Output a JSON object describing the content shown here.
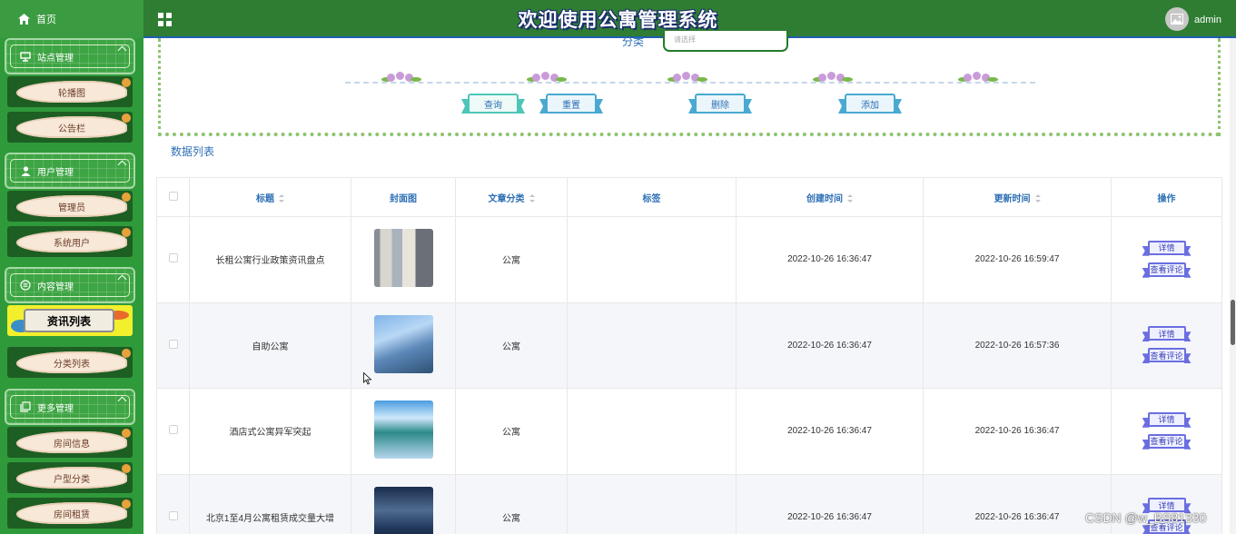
{
  "header": {
    "home_label": "首页",
    "system_title": "欢迎使用公寓管理系统",
    "username": "admin"
  },
  "sidebar": {
    "groups": [
      {
        "label": "站点管理",
        "icon": "monitor-icon",
        "items": [
          "轮播图",
          "公告栏"
        ]
      },
      {
        "label": "用户管理",
        "icon": "user-icon",
        "items": [
          "管理员",
          "系统用户"
        ]
      },
      {
        "label": "内容管理",
        "icon": "list-circle-icon",
        "items": [
          "资讯列表",
          "分类列表"
        ]
      },
      {
        "label": "更多管理",
        "icon": "copy-icon",
        "items": [
          "房间信息",
          "户型分类",
          "房间租赁"
        ]
      }
    ],
    "active_item": "资讯列表"
  },
  "search": {
    "category_label": "分类",
    "category_placeholder": "请选择",
    "buttons": {
      "query": "查询",
      "reset": "重置",
      "delete": "删除",
      "add": "添加"
    }
  },
  "list_title": "数据列表",
  "table": {
    "headers": {
      "title": "标题",
      "cover": "封面图",
      "category": "文章分类",
      "tags": "标签",
      "created": "创建时间",
      "updated": "更新时间",
      "actions": "操作"
    },
    "rows": [
      {
        "title": "长租公寓行业政策资讯盘点",
        "category": "公寓",
        "tags": "",
        "created": "2022-10-26 16:36:47",
        "updated": "2022-10-26 16:59:47"
      },
      {
        "title": "自助公寓",
        "category": "公寓",
        "tags": "",
        "created": "2022-10-26 16:36:47",
        "updated": "2022-10-26 16:57:36"
      },
      {
        "title": "酒店式公寓异军突起",
        "category": "公寓",
        "tags": "",
        "created": "2022-10-26 16:36:47",
        "updated": "2022-10-26 16:36:47"
      },
      {
        "title": "北京1至4月公寓租赁成交量大增",
        "category": "公寓",
        "tags": "",
        "created": "2022-10-26 16:36:47",
        "updated": "2022-10-26 16:36:47"
      }
    ],
    "action_labels": {
      "detail": "详情",
      "comments": "查看评论"
    }
  },
  "watermark": "CSDN @w_BS81330"
}
